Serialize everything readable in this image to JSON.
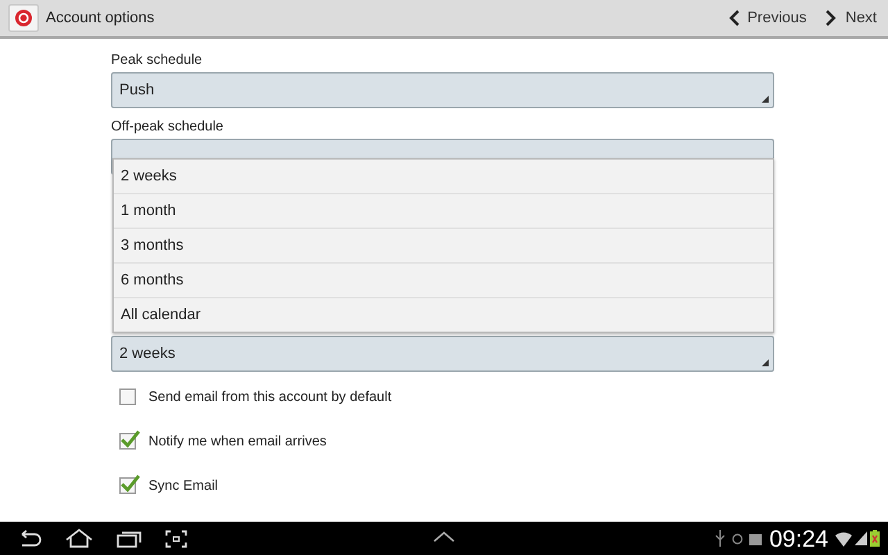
{
  "action_bar": {
    "title": "Account options",
    "previous": "Previous",
    "next": "Next"
  },
  "fields": [
    {
      "label": "Peak schedule",
      "value": "Push"
    },
    {
      "label": "Off-peak schedule"
    },
    {
      "value": "2 weeks"
    }
  ],
  "dropdown": {
    "options": [
      {
        "label": "2 weeks"
      },
      {
        "label": "1 month"
      },
      {
        "label": "3 months"
      },
      {
        "label": "6 months"
      },
      {
        "label": "All calendar"
      }
    ]
  },
  "checkboxes": [
    {
      "label": "Send email from this account by default",
      "checked": false
    },
    {
      "label": "Notify me when email arrives",
      "checked": true
    },
    {
      "label": "Sync Email",
      "checked": true
    }
  ],
  "status_bar": {
    "time": "09:24"
  }
}
